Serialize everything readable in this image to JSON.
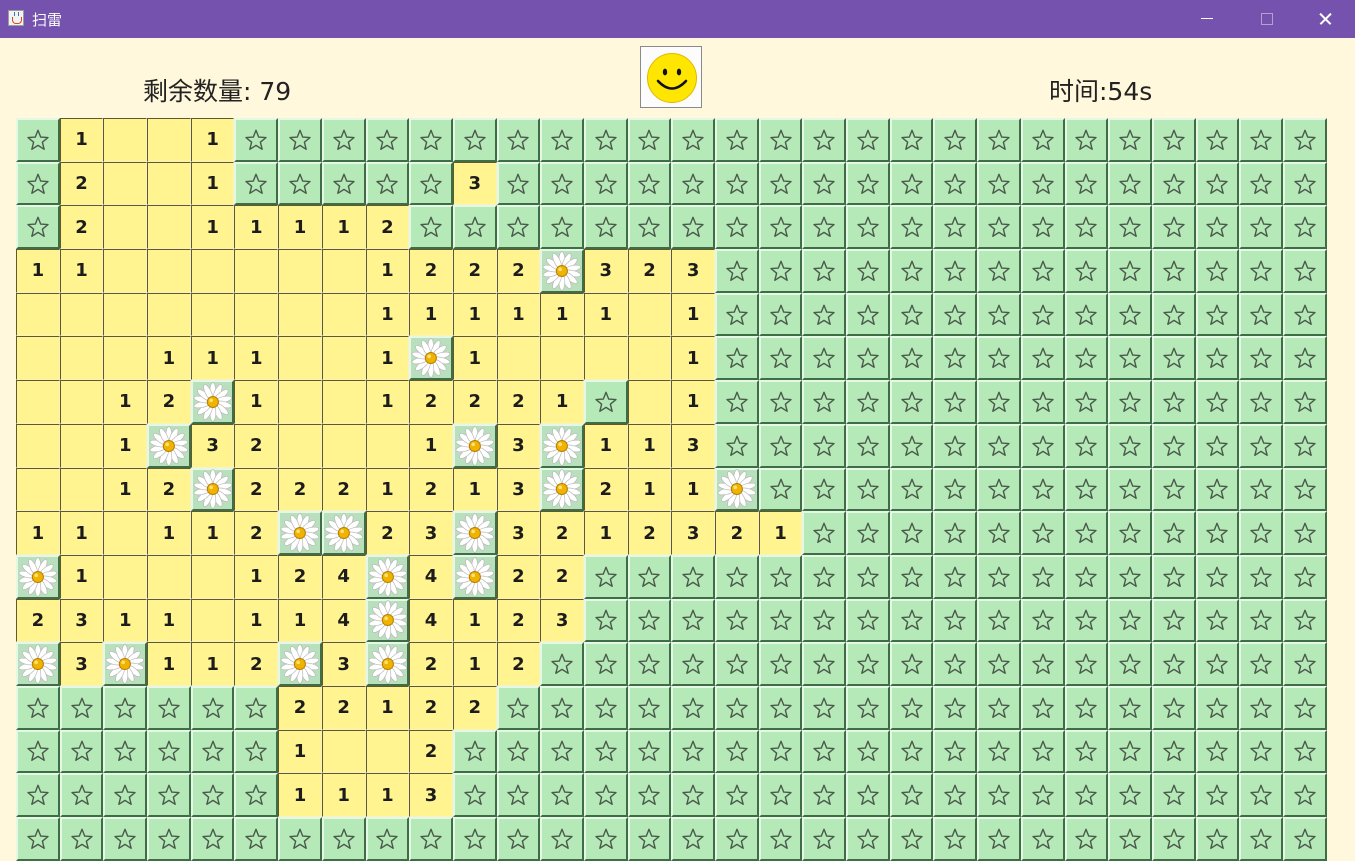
{
  "window": {
    "title": "扫雷",
    "titlebar_color": "#7452ad"
  },
  "header": {
    "remaining_label": "剩余数量: 79",
    "timer_label": "时间:54s",
    "face": "smiley-face-icon"
  },
  "board": {
    "cols": 30,
    "visible_rows": 17,
    "legend": {
      "#": "covered cell (star-icon)",
      "M": "revealed mine (flower-mine-icon)",
      ".": "open empty cell",
      "1-9": "open cell with adjacent mine count"
    },
    "colors": {
      "covered": "#b5e9b8",
      "open": "#fff48f",
      "number": "#1c1c1c"
    },
    "rows": [
      "#1..1#########################",
      "#2..1#####3###################",
      "#2..11112#####################",
      "11......1222M323##############",
      "........111111.1##############",
      "...111..1M1....1##############",
      "..12M1..12221#.1##############",
      "..1M32...1M3M113##############",
      "..12M2221213M211M#############",
      "11.112MM23M3212321############",
      "M1...124M4M22#################",
      "2311.114M4123#################",
      "M3M112M3M212##################",
      "######22122###################",
      "######1..2####################",
      "######1113####################",
      "##############################"
    ]
  }
}
